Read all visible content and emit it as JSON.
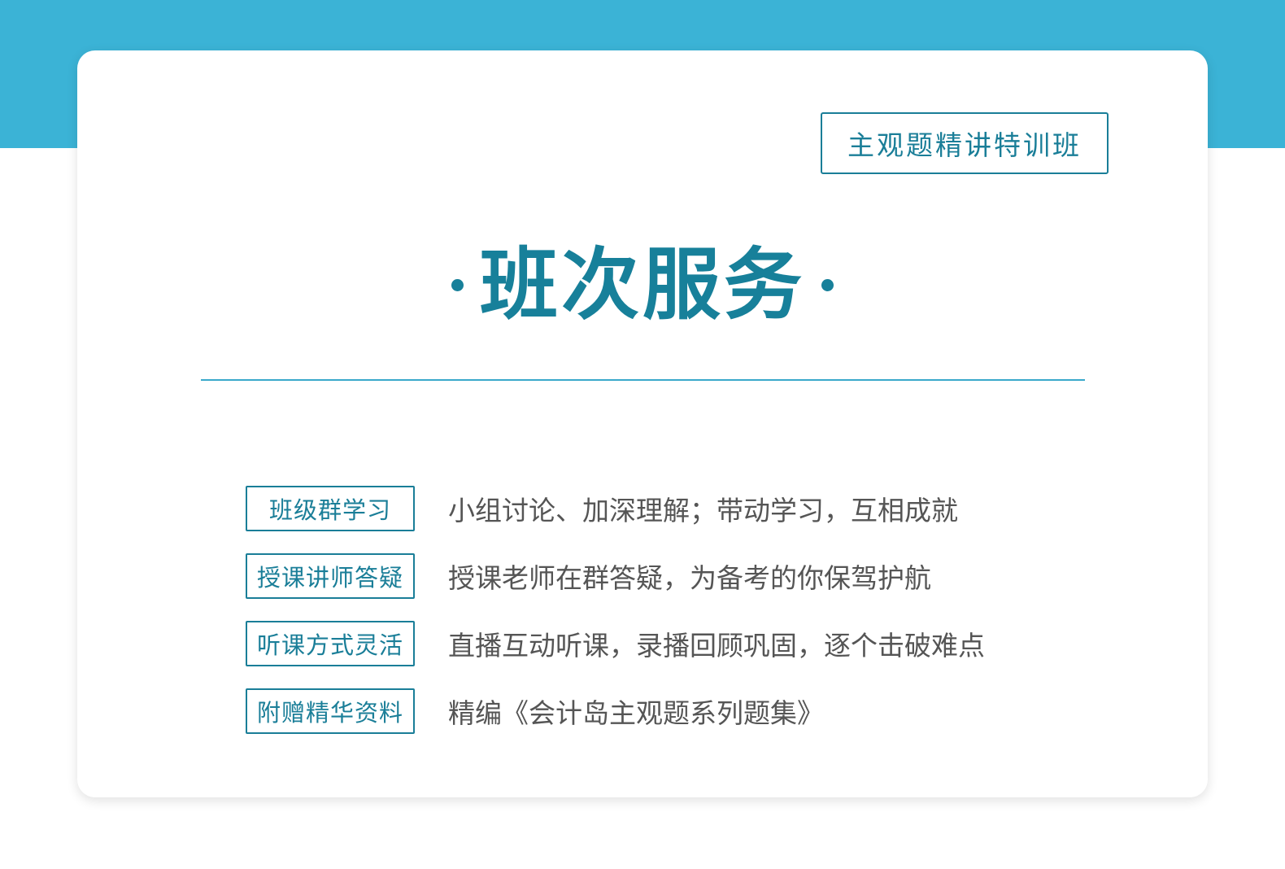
{
  "colors": {
    "band": "#3bb3d6",
    "accent": "#17809a",
    "text": "#555555",
    "divider": "#3aa9cb"
  },
  "badge": {
    "label": "主观题精讲特训班"
  },
  "title": {
    "text": "班次服务"
  },
  "services": [
    {
      "tag": "班级群学习",
      "desc": "小组讨论、加深理解；带动学习，互相成就"
    },
    {
      "tag": "授课讲师答疑",
      "desc": "授课老师在群答疑，为备考的你保驾护航"
    },
    {
      "tag": "听课方式灵活",
      "desc": "直播互动听课，录播回顾巩固，逐个击破难点"
    },
    {
      "tag": "附赠精华资料",
      "desc": "精编《会计岛主观题系列题集》"
    }
  ]
}
